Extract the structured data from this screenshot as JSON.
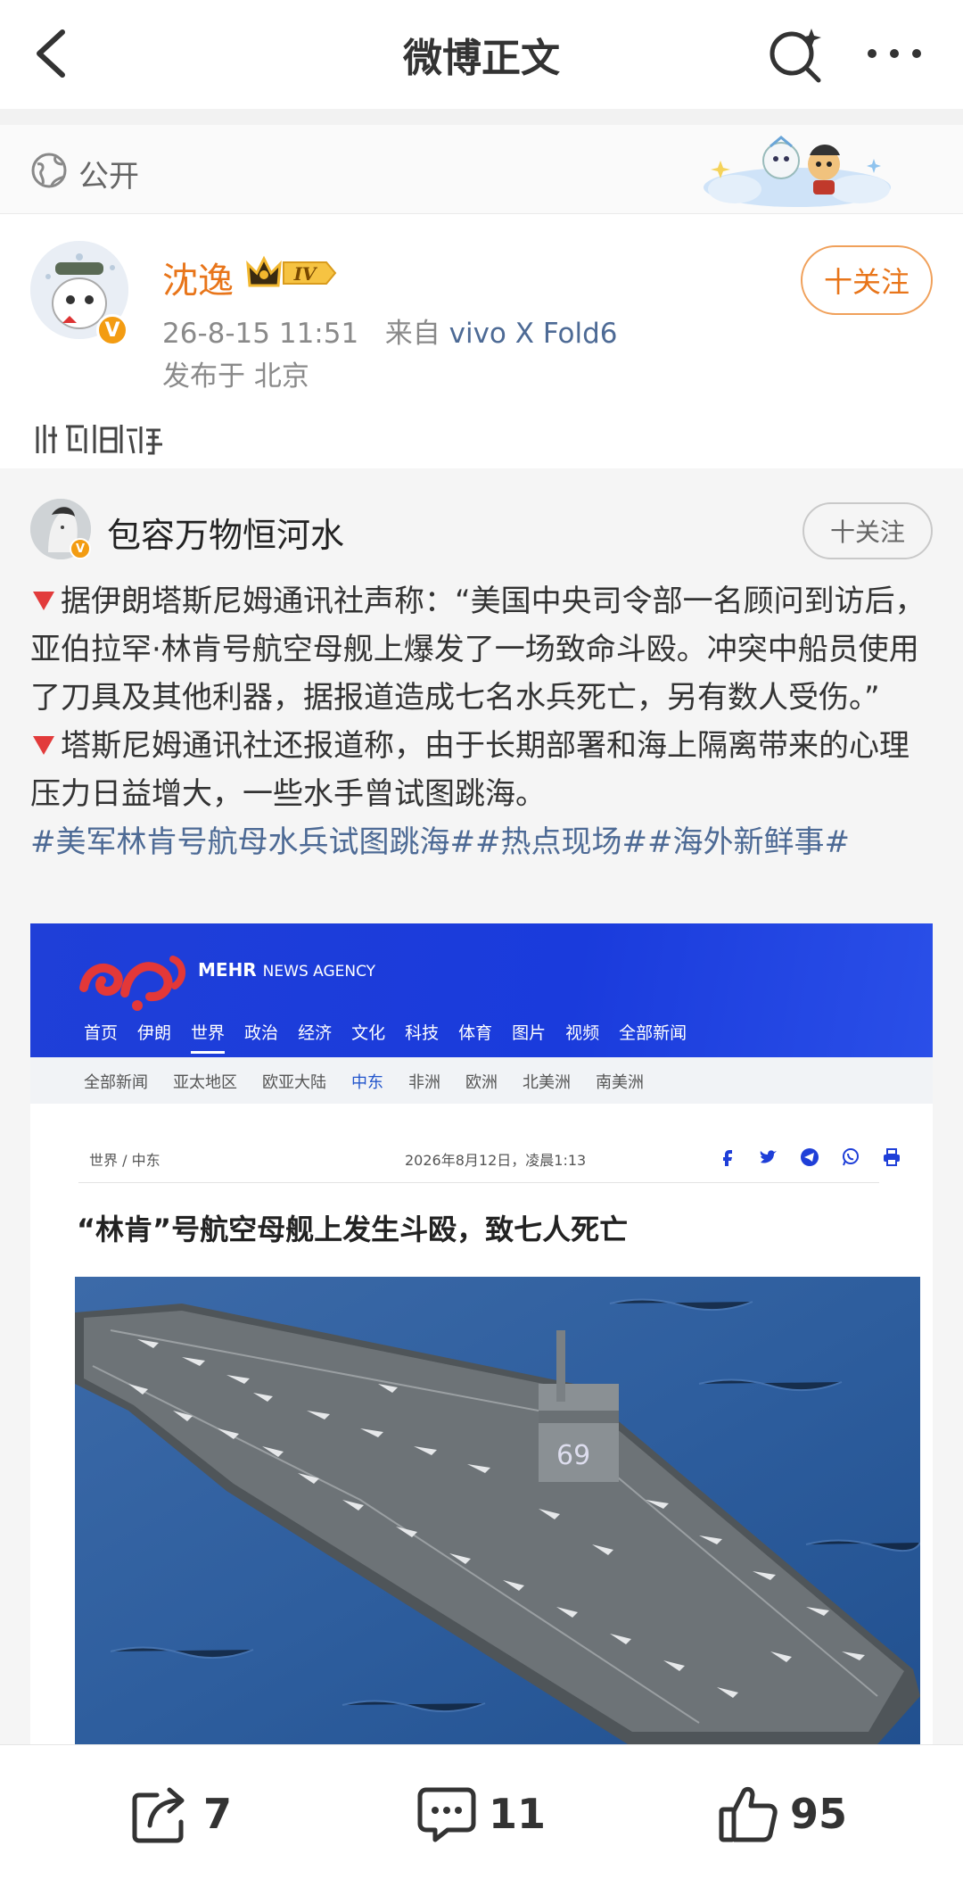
{
  "nav": {
    "title": "微博正文"
  },
  "visibility": {
    "label": "公开"
  },
  "author": {
    "name": "沈逸",
    "level": "IV",
    "verified_badge": "V",
    "timestamp": "26-8-15 11:51",
    "source_prefix": "来自",
    "source_device": "vivo X Fold6",
    "location": "发布于 北京",
    "follow_label": "十关注"
  },
  "repost": {
    "user": "包容万物恒河水",
    "verified_badge": "V",
    "follow_label": "十关注",
    "para1": "据伊朗塔斯尼姆通讯社声称：“美国中央司令部一名顾问到访后，亚伯拉罕·林肯号航空母舰上爆发了一场致命斗殴。冲突中船员使用了刀具及其他利器，据报道造成七名水兵死亡，另有数人受伤。”",
    "para2": "塔斯尼姆通讯社还报道称，由于长期部署和海上隔离带来的心理压力日益增大，一些水手曾试图跳海。",
    "hashtags": "#美军林肯号航母水兵试图跳海##热点现场##海外新鲜事#"
  },
  "screenshot": {
    "brand": "MEHR",
    "brand_suffix": "NEWS AGENCY",
    "nav": [
      "首页",
      "伊朗",
      "世界",
      "政治",
      "经济",
      "文化",
      "科技",
      "体育",
      "图片",
      "视频",
      "全部新闻"
    ],
    "nav_active": "世界",
    "subnav": [
      "全部新闻",
      "亚太地区",
      "欧亚大陆",
      "中东",
      "非洲",
      "欧洲",
      "北美洲",
      "南美洲"
    ],
    "subnav_active": "中东",
    "breadcrumb": "世界  /   中东",
    "date": "2026年8月12日，凌晨1:13",
    "headline": "“林肯”号航空母舰上发生斗殴，致七人死亡"
  },
  "actions": {
    "repost_count": "7",
    "comment_count": "11",
    "like_count": "95"
  },
  "colors": {
    "accent_orange": "#e8751a",
    "link_blue": "#4d6a95",
    "mehr_blue": "#1f3fd8"
  }
}
